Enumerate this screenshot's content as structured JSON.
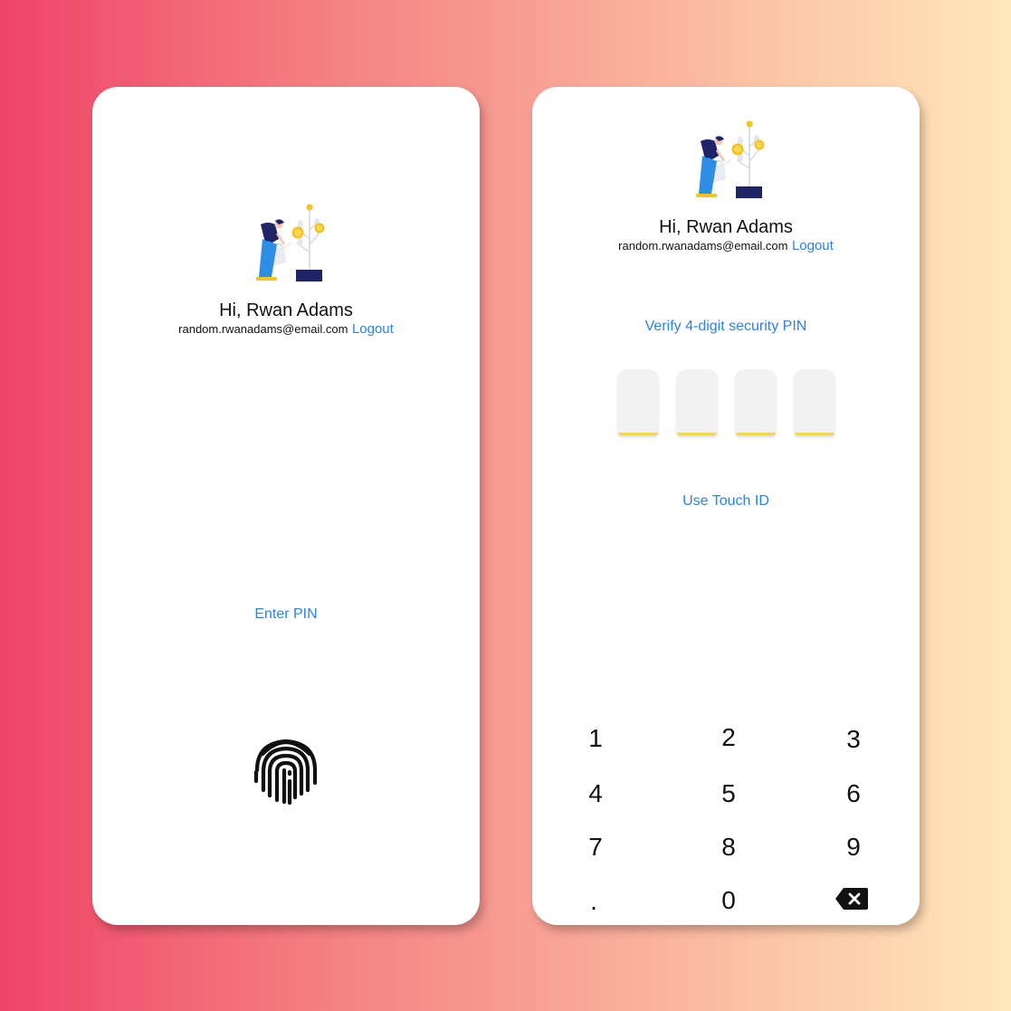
{
  "user": {
    "greeting": "Hi, Rwan Adams",
    "email": "random.rwanadams@email.com",
    "logout_label": "Logout"
  },
  "left_screen": {
    "enter_pin_label": "Enter PIN",
    "icon": "fingerprint-icon"
  },
  "right_screen": {
    "verify_label": "Verify 4-digit security PIN",
    "touch_id_label": "Use Touch ID",
    "pin_digits": [
      "",
      "",
      "",
      ""
    ],
    "keypad": [
      "1",
      "2",
      "3",
      "4",
      "5",
      "6",
      "7",
      "8",
      "9",
      ".",
      "0"
    ],
    "backspace_icon": "backspace-icon"
  },
  "colors": {
    "accent": "#2a83e6",
    "pin_underline": "#f5d64c",
    "illustration_navy": "#1f2466",
    "illustration_blue": "#2e8ee6",
    "illustration_yellow": "#f6c21c"
  }
}
